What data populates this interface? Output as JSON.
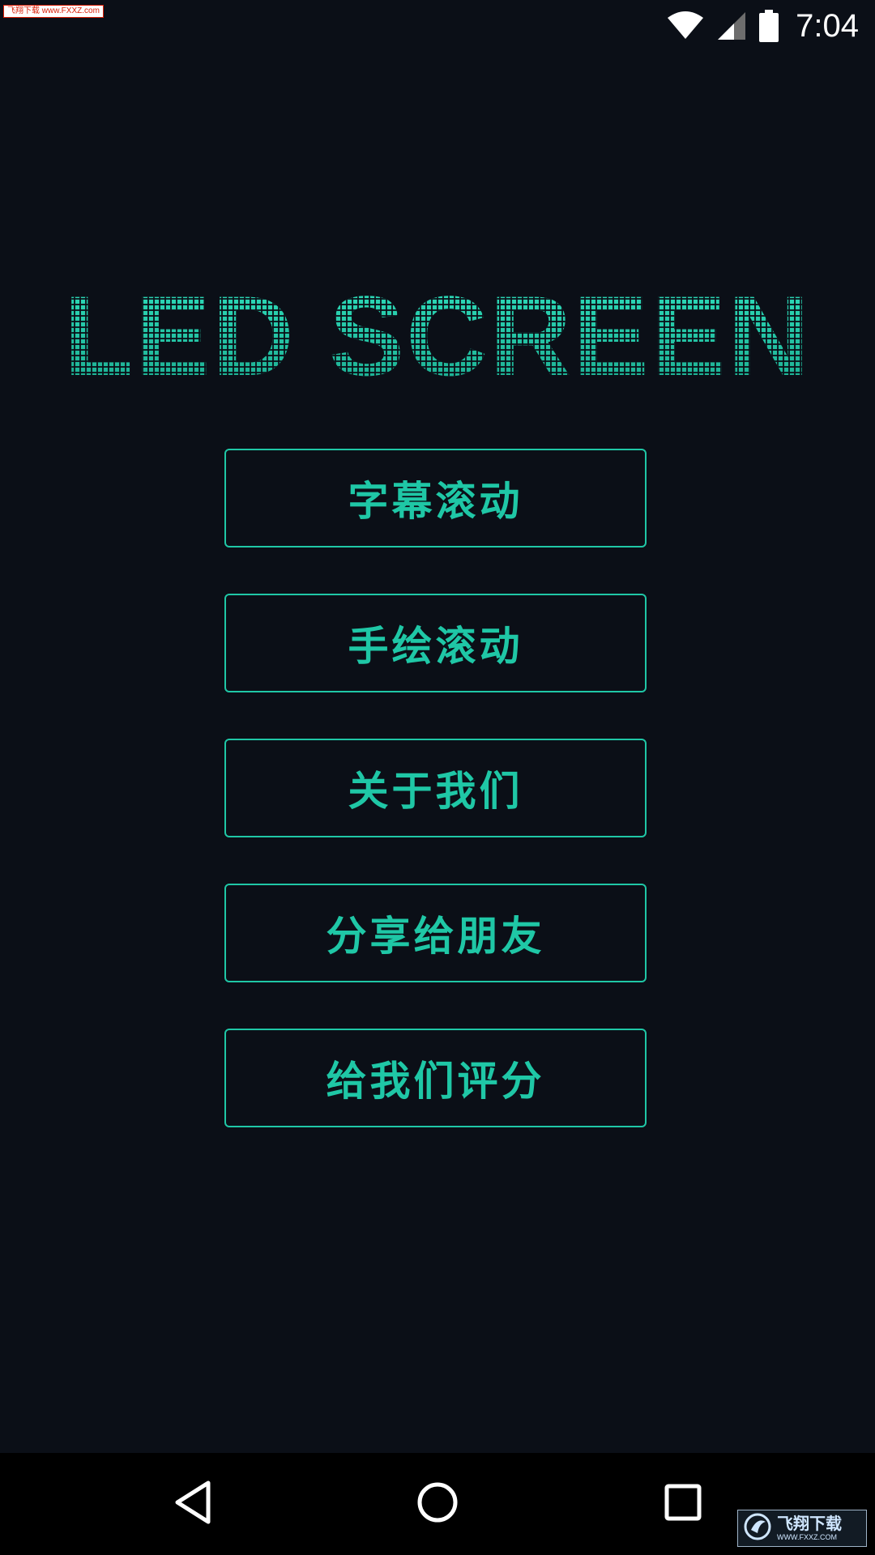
{
  "status_bar": {
    "watermark": "飞翔下载 www.FXXZ.com",
    "time": "7:04",
    "icons": [
      "wifi-icon",
      "cell-signal-icon",
      "battery-icon"
    ]
  },
  "title": "LED SCREEN",
  "menu": {
    "items": [
      {
        "label": "字幕滚动"
      },
      {
        "label": "手绘滚动"
      },
      {
        "label": "关于我们"
      },
      {
        "label": "分享给朋友"
      },
      {
        "label": "给我们评分"
      }
    ]
  },
  "nav_bar": {
    "icons": [
      "back-icon",
      "home-icon",
      "recents-icon"
    ]
  },
  "watermark_bottom": {
    "cn": "飞翔下载",
    "url": "WWW.FXXZ.COM"
  },
  "colors": {
    "accent": "#1fc7a6",
    "background": "#0b0f17",
    "nav_background": "#000000"
  }
}
